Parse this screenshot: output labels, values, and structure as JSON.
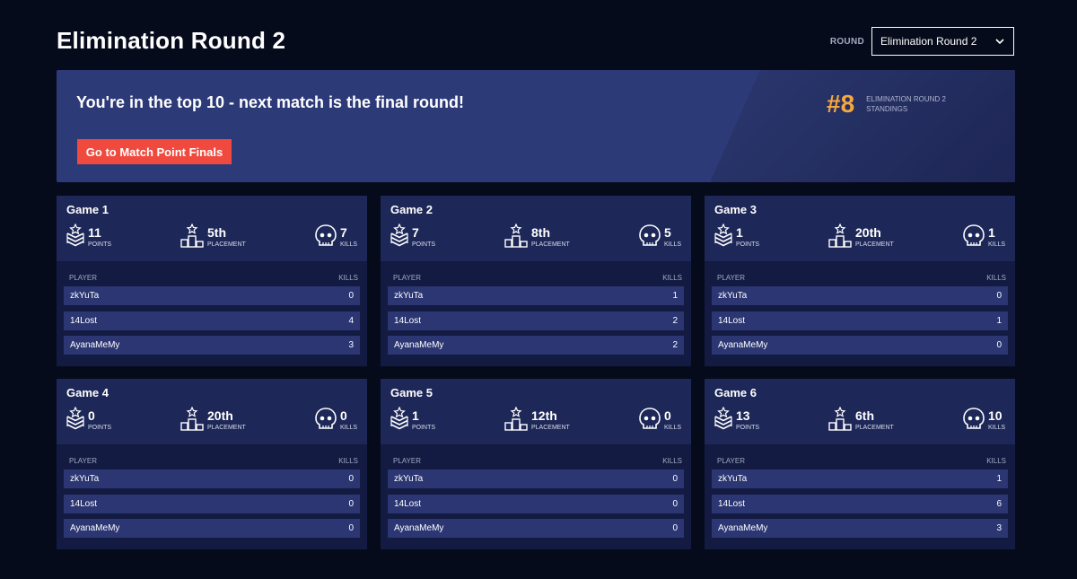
{
  "header": {
    "title": "Elimination Round 2",
    "round_label": "ROUND",
    "round_selected": "Elimination Round 2"
  },
  "banner": {
    "message": "You're in the top 10 - next match is the final round!",
    "cta_label": "Go to Match Point Finals",
    "rank": "#8",
    "rank_label": "ELIMINATION ROUND 2 STANDINGS"
  },
  "labels": {
    "points": "POINTS",
    "placement": "PLACEMENT",
    "kills": "KILLS",
    "col_player": "PLAYER",
    "col_kills": "KILLS"
  },
  "games": [
    {
      "title": "Game 1",
      "points": "11",
      "placement": "5th",
      "kills": "7",
      "players": [
        {
          "name": "zkYuTa",
          "kills": "0"
        },
        {
          "name": "14Lost",
          "kills": "4"
        },
        {
          "name": "AyanaMeMy",
          "kills": "3"
        }
      ]
    },
    {
      "title": "Game 2",
      "points": "7",
      "placement": "8th",
      "kills": "5",
      "players": [
        {
          "name": "zkYuTa",
          "kills": "1"
        },
        {
          "name": "14Lost",
          "kills": "2"
        },
        {
          "name": "AyanaMeMy",
          "kills": "2"
        }
      ]
    },
    {
      "title": "Game 3",
      "points": "1",
      "placement": "20th",
      "kills": "1",
      "players": [
        {
          "name": "zkYuTa",
          "kills": "0"
        },
        {
          "name": "14Lost",
          "kills": "1"
        },
        {
          "name": "AyanaMeMy",
          "kills": "0"
        }
      ]
    },
    {
      "title": "Game 4",
      "points": "0",
      "placement": "20th",
      "kills": "0",
      "players": [
        {
          "name": "zkYuTa",
          "kills": "0"
        },
        {
          "name": "14Lost",
          "kills": "0"
        },
        {
          "name": "AyanaMeMy",
          "kills": "0"
        }
      ]
    },
    {
      "title": "Game 5",
      "points": "1",
      "placement": "12th",
      "kills": "0",
      "players": [
        {
          "name": "zkYuTa",
          "kills": "0"
        },
        {
          "name": "14Lost",
          "kills": "0"
        },
        {
          "name": "AyanaMeMy",
          "kills": "0"
        }
      ]
    },
    {
      "title": "Game 6",
      "points": "13",
      "placement": "6th",
      "kills": "10",
      "players": [
        {
          "name": "zkYuTa",
          "kills": "1"
        },
        {
          "name": "14Lost",
          "kills": "6"
        },
        {
          "name": "AyanaMeMy",
          "kills": "3"
        }
      ]
    }
  ],
  "colors": {
    "background": "#060b1c",
    "banner": "#2d3a78",
    "cta": "#f04a3f",
    "rank": "#f5a83b",
    "card": "#131b42",
    "card_header": "#1e2858",
    "row": "#2b3672"
  },
  "icons": {
    "points": "chevron-rank-icon",
    "placement": "podium-icon",
    "kills": "skull-icon",
    "select": "chevron-down-icon"
  }
}
